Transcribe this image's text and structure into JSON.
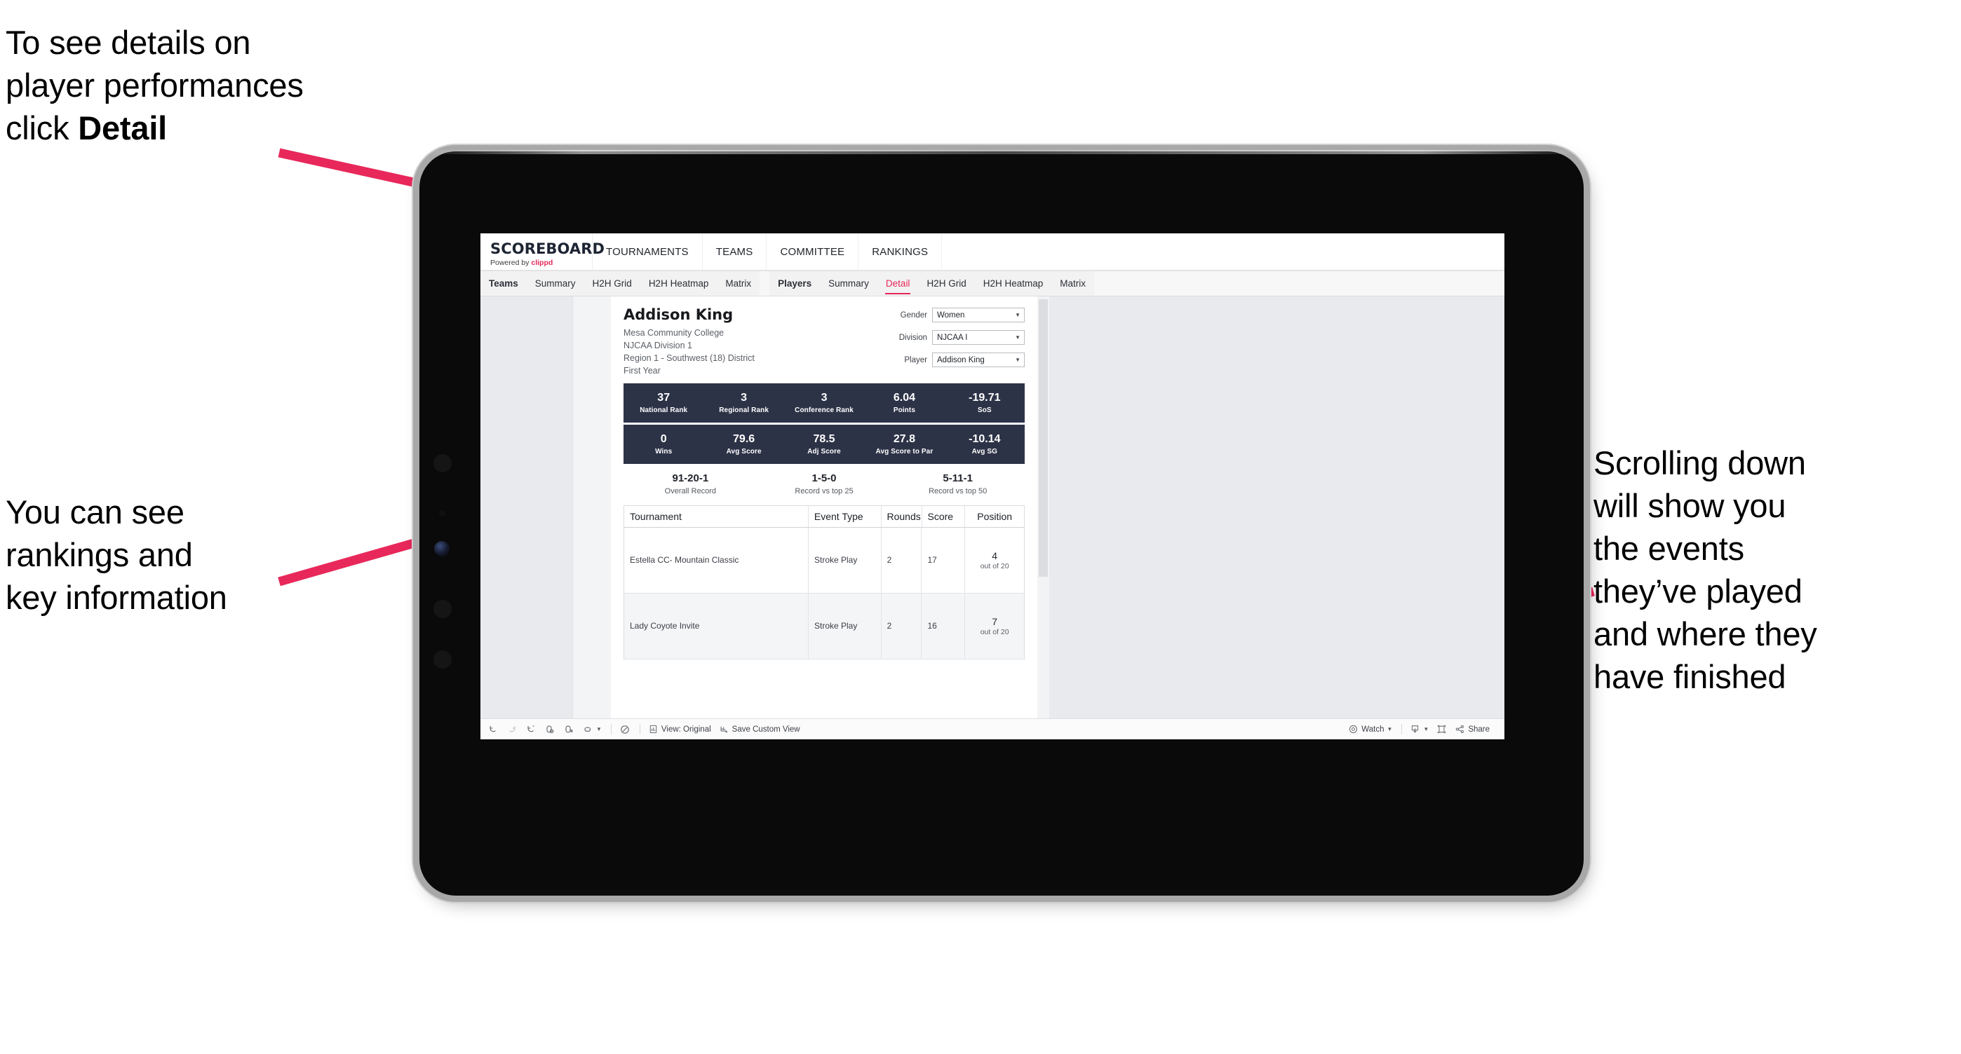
{
  "annotations": {
    "top_left": "To see details on\nplayer performances\nclick ",
    "top_left_bold": "Detail",
    "bottom_left": "You can see\nrankings and\nkey information",
    "right": "Scrolling down\nwill show you\nthe events\nthey’ve played\nand where they\nhave finished"
  },
  "colors": {
    "accent_pink": "#e8285a",
    "stat_navy": "#2d3347",
    "canvas_gray": "#e8eaed"
  },
  "topnav": {
    "brand_title": "SCOREBOARD",
    "brand_sub_prefix": "Powered by ",
    "brand_sub_name": "clippd",
    "items": [
      "TOURNAMENTS",
      "TEAMS",
      "COMMITTEE",
      "RANKINGS"
    ]
  },
  "subnav": {
    "teams_group": [
      "Teams",
      "Summary",
      "H2H Grid",
      "H2H Heatmap",
      "Matrix"
    ],
    "players_group": [
      "Players",
      "Summary",
      "Detail",
      "H2H Grid",
      "H2H Heatmap",
      "Matrix"
    ],
    "active_tab": "Detail"
  },
  "player": {
    "name": "Addison King",
    "school": "Mesa Community College",
    "division": "NJCAA Division 1",
    "region": "Region 1 - Southwest (18) District",
    "year": "First Year"
  },
  "selectors": [
    {
      "label": "Gender",
      "value": "Women"
    },
    {
      "label": "Division",
      "value": "NJCAA I"
    },
    {
      "label": "Player",
      "value": "Addison King"
    }
  ],
  "stats_row_1": [
    {
      "value": "37",
      "label": "National Rank"
    },
    {
      "value": "3",
      "label": "Regional Rank"
    },
    {
      "value": "3",
      "label": "Conference Rank"
    },
    {
      "value": "6.04",
      "label": "Points"
    },
    {
      "value": "-19.71",
      "label": "SoS"
    }
  ],
  "stats_row_2": [
    {
      "value": "0",
      "label": "Wins"
    },
    {
      "value": "79.6",
      "label": "Avg Score"
    },
    {
      "value": "78.5",
      "label": "Adj Score"
    },
    {
      "value": "27.8",
      "label": "Avg Score to Par"
    },
    {
      "value": "-10.14",
      "label": "Avg SG"
    }
  ],
  "records": [
    {
      "value": "91-20-1",
      "label": "Overall Record"
    },
    {
      "value": "1-5-0",
      "label": "Record vs top 25"
    },
    {
      "value": "5-11-1",
      "label": "Record vs top 50"
    }
  ],
  "events_table": {
    "headers": [
      "Tournament",
      "Event Type",
      "Rounds",
      "Score",
      "Position"
    ],
    "rows": [
      {
        "tournament": "Estella CC- Mountain Classic",
        "event_type": "Stroke Play",
        "rounds": "2",
        "score": "17",
        "position_num": "4",
        "position_of": "out of 20"
      },
      {
        "tournament": "Lady Coyote Invite",
        "event_type": "Stroke Play",
        "rounds": "2",
        "score": "16",
        "position_num": "7",
        "position_of": "out of 20"
      }
    ]
  },
  "toolbar": {
    "undo": "undo-icon",
    "redo": "redo-icon",
    "revert": "revert-icon",
    "refresh": "refresh-icon",
    "pause": "pause-icon",
    "zoom": "zoom-icon",
    "alert": "alert-icon",
    "view_label": "View: Original",
    "save_custom_view_label": "Save Custom View",
    "watch_label": "Watch",
    "download": "download-icon",
    "fullscreen": "fullscreen-icon",
    "share_label": "Share"
  }
}
